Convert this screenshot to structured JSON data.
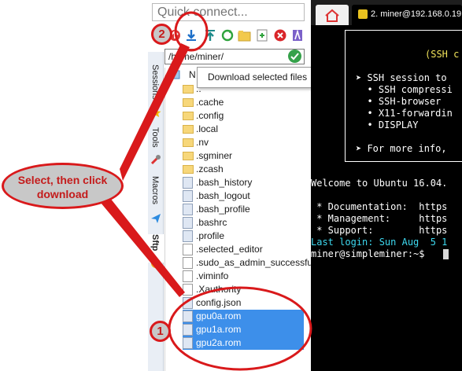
{
  "quick_connect": {
    "placeholder": "Quick connect..."
  },
  "sidebar": {
    "tabs": [
      {
        "label": "Sessions"
      },
      {
        "label": "Tools"
      },
      {
        "label": "Macros"
      },
      {
        "label": "Sftp"
      }
    ]
  },
  "sftp": {
    "path": "/home/miner/",
    "column_header": "N",
    "tooltip": "Download selected files",
    "files": [
      {
        "name": "..",
        "type": "folder",
        "selected": false
      },
      {
        "name": ".cache",
        "type": "folder",
        "selected": false
      },
      {
        "name": ".config",
        "type": "folder",
        "selected": false
      },
      {
        "name": ".local",
        "type": "folder",
        "selected": false
      },
      {
        "name": ".nv",
        "type": "folder",
        "selected": false
      },
      {
        "name": ".sgminer",
        "type": "folder",
        "selected": false
      },
      {
        "name": ".zcash",
        "type": "folder",
        "selected": false
      },
      {
        "name": ".bash_history",
        "type": "file",
        "selected": false
      },
      {
        "name": ".bash_logout",
        "type": "file",
        "selected": false
      },
      {
        "name": ".bash_profile",
        "type": "file",
        "selected": false
      },
      {
        "name": ".bashrc",
        "type": "file",
        "selected": false
      },
      {
        "name": ".profile",
        "type": "file",
        "selected": false
      },
      {
        "name": ".selected_editor",
        "type": "doc",
        "selected": false
      },
      {
        "name": ".sudo_as_admin_successful",
        "type": "doc",
        "selected": false
      },
      {
        "name": ".viminfo",
        "type": "doc",
        "selected": false
      },
      {
        "name": ".Xauthority",
        "type": "doc",
        "selected": false
      },
      {
        "name": "config.json",
        "type": "json",
        "selected": false
      },
      {
        "name": "gpu0a.rom",
        "type": "file",
        "selected": true
      },
      {
        "name": "gpu1a.rom",
        "type": "file",
        "selected": true
      },
      {
        "name": "gpu2a.rom",
        "type": "file",
        "selected": true
      }
    ]
  },
  "terminal": {
    "tab_label": "2. miner@192.168.0.19",
    "box_lines": [
      "(SSH c",
      "➤ SSH session to",
      "  • SSH compressi",
      "  • SSH-browser",
      "  • X11-forwardin",
      "  • DISPLAY",
      "➤ For more info,"
    ],
    "lines": [
      "Welcome to Ubuntu 16.04.",
      " * Documentation:  https",
      " * Management:     https",
      " * Support:        https",
      "Last login: Sun Aug  5 1",
      "miner@simpleminer:~$ "
    ]
  },
  "annotation": {
    "callout_text": "Select, then click download",
    "step1": "1",
    "step2": "2",
    "color": "#d9191b"
  }
}
